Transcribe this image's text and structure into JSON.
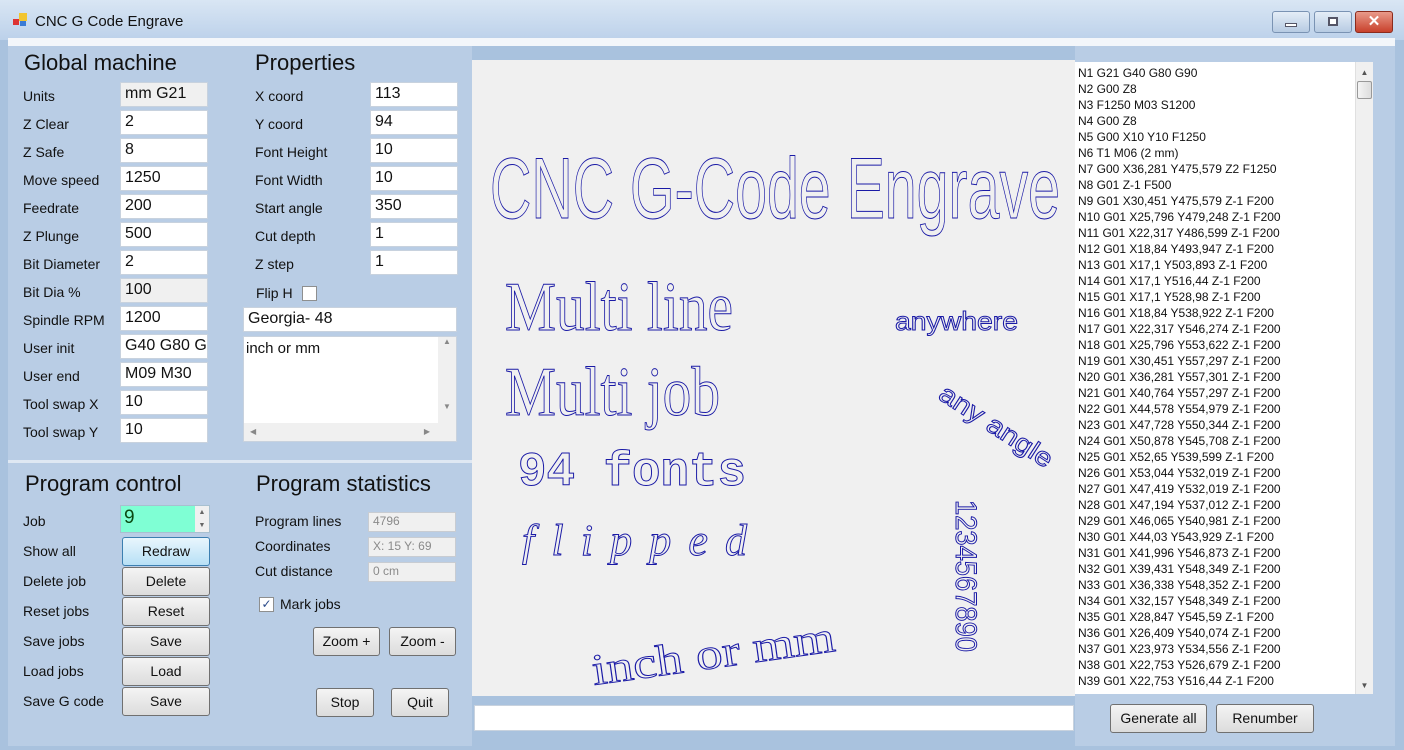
{
  "window": {
    "title": "CNC G Code Engrave",
    "minimize": "minimize",
    "maximize": "maximize",
    "close": "✕"
  },
  "global": {
    "heading": "Global machine",
    "rows": [
      {
        "label": "Units",
        "value": "mm G21",
        "readonly": true
      },
      {
        "label": "Z Clear",
        "value": "2"
      },
      {
        "label": "Z Safe",
        "value": "8"
      },
      {
        "label": "Move speed",
        "value": "1250"
      },
      {
        "label": "Feedrate",
        "value": "200"
      },
      {
        "label": "Z Plunge",
        "value": "500"
      },
      {
        "label": "Bit Diameter",
        "value": "2"
      },
      {
        "label": "Bit Dia %",
        "value": "100",
        "readonly": true
      },
      {
        "label": "Spindle RPM",
        "value": "1200"
      },
      {
        "label": "User init",
        "value": "G40 G80 G"
      },
      {
        "label": "User end",
        "value": "M09 M30"
      },
      {
        "label": "Tool swap X",
        "value": "10"
      },
      {
        "label": "Tool swap Y",
        "value": "10"
      }
    ]
  },
  "properties": {
    "heading": "Properties",
    "rows": [
      {
        "label": "X coord",
        "value": "113"
      },
      {
        "label": "Y coord",
        "value": "94"
      },
      {
        "label": "Font Height",
        "value": "10"
      },
      {
        "label": "Font Width",
        "value": "10"
      },
      {
        "label": "Start angle",
        "value": "350"
      },
      {
        "label": "Cut depth",
        "value": "1"
      },
      {
        "label": "Z step",
        "value": "1"
      }
    ],
    "flip_h_label": "Flip H",
    "flip_h_checked": false,
    "font": "Georgia- 48",
    "text": "inch or mm"
  },
  "control": {
    "heading": "Program control",
    "job_label": "Job",
    "job_value": "9",
    "job_bg": "#7fffd4",
    "rows": [
      {
        "label": "Show all",
        "button": "Redraw"
      },
      {
        "label": "Delete job",
        "button": "Delete"
      },
      {
        "label": "Reset jobs",
        "button": "Reset"
      },
      {
        "label": "Save jobs",
        "button": "Save"
      },
      {
        "label": "Load jobs",
        "button": "Load"
      },
      {
        "label": "Save G code",
        "button": "Save"
      }
    ]
  },
  "stats": {
    "heading": "Program statistics",
    "rows": [
      {
        "label": "Program lines",
        "value": "4796"
      },
      {
        "label": "Coordinates",
        "value": "X: 15  Y: 69"
      },
      {
        "label": "Cut distance",
        "value": "0 cm"
      }
    ],
    "mark_jobs_label": "Mark jobs",
    "mark_jobs_checked": true,
    "zoom_in": "Zoom +",
    "zoom_out": "Zoom -",
    "stop": "Stop",
    "quit": "Quit"
  },
  "preview": {
    "stroke_color": "#1a1aa6",
    "texts": [
      "CNC G-Code Engrave",
      "Multi line",
      "Multi job",
      "94 fonts",
      "flipped",
      "inch or mm",
      "anywhere",
      "any angle",
      "1234567890"
    ]
  },
  "gcode": [
    "N1 G21 G40 G80 G90",
    "N2 G00 Z8",
    "N3  F1250 M03 S1200",
    "N4 G00 Z8",
    "N5 G00 X10 Y10 F1250",
    "N6 T1 M06 (2 mm)",
    "N7 G00 X36,281 Y475,579 Z2 F1250",
    "N8 G01 Z-1 F500",
    "N9 G01 X30,451 Y475,579 Z-1 F200",
    "N10 G01 X25,796 Y479,248 Z-1 F200",
    "N11 G01 X22,317 Y486,599 Z-1 F200",
    "N12 G01 X18,84 Y493,947 Z-1 F200",
    "N13 G01 X17,1 Y503,893 Z-1 F200",
    "N14 G01 X17,1 Y516,44 Z-1 F200",
    "N15 G01 X17,1 Y528,98 Z-1 F200",
    "N16 G01 X18,84 Y538,922 Z-1 F200",
    "N17 G01 X22,317 Y546,274 Z-1 F200",
    "N18 G01 X25,796 Y553,622 Z-1 F200",
    "N19 G01 X30,451 Y557,297 Z-1 F200",
    "N20 G01 X36,281 Y557,301 Z-1 F200",
    "N21 G01 X40,764 Y557,297 Z-1 F200",
    "N22 G01 X44,578 Y554,979 Z-1 F200",
    "N23 G01 X47,728 Y550,344 Z-1 F200",
    "N24 G01 X50,878 Y545,708 Z-1 F200",
    "N25 G01 X52,65 Y539,599 Z-1 F200",
    "N26 G01 X53,044 Y532,019 Z-1 F200",
    "N27 G01 X47,419 Y532,019 Z-1 F200",
    "N28 G01 X47,194 Y537,012 Z-1 F200",
    "N29 G01 X46,065 Y540,981 Z-1 F200",
    "N30 G01 X44,03 Y543,929 Z-1 F200",
    "N31 G01 X41,996 Y546,873 Z-1 F200",
    "N32 G01 X39,431 Y548,349 Z-1 F200",
    "N33 G01 X36,338 Y548,352 Z-1 F200",
    "N34 G01 X32,157 Y548,349 Z-1 F200",
    "N35 G01 X28,847 Y545,59 Z-1 F200",
    "N36 G01 X26,409 Y540,074 Z-1 F200",
    "N37 G01 X23,973 Y534,556 Z-1 F200",
    "N38 G01 X22,753 Y526,679 Z-1 F200",
    "N39 G01 X22,753 Y516,44 Z-1 F200"
  ],
  "bottom": {
    "command_value": "",
    "generate_all": "Generate all",
    "renumber": "Renumber"
  }
}
